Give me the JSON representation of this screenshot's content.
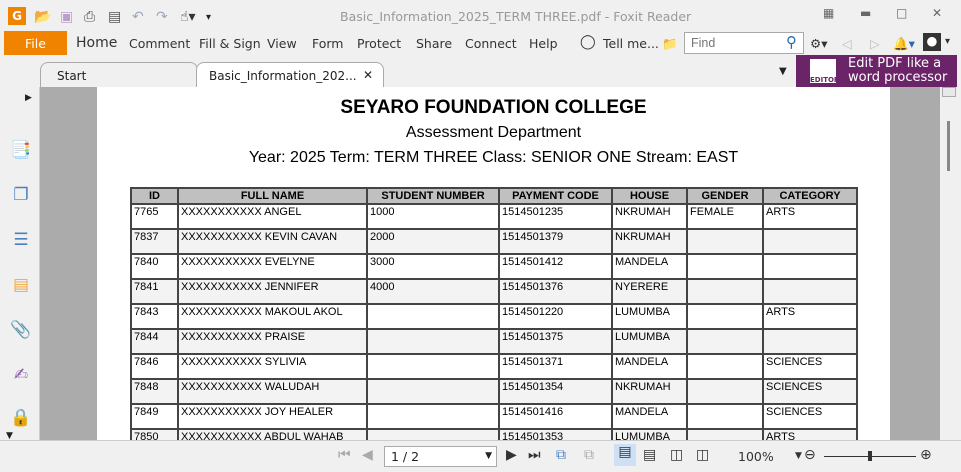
{
  "app": {
    "title": "Basic_Information_2025_TERM THREE.pdf - Foxit Reader",
    "accent": "#f08300"
  },
  "quick_access": [
    "foxit-logo-icon",
    "open-folder-icon",
    "save-icon",
    "print-icon",
    "scan-icon",
    "undo-icon",
    "redo-icon",
    "hand-tool-icon",
    "customize-icon"
  ],
  "ribbon": {
    "file": "File",
    "tabs": [
      "Home",
      "Comment",
      "Fill & Sign",
      "View",
      "Form",
      "Protect",
      "Share",
      "Connect",
      "Help"
    ],
    "tell_me": "Tell me...",
    "find_placeholder": "Find"
  },
  "doc_tabs": [
    {
      "label": "Start"
    },
    {
      "label": "Basic_Information_202...",
      "active": true
    }
  ],
  "promo": {
    "line1": "Edit PDF like a",
    "line2": "word processor",
    "badge": "EDITOR",
    "color": "#6b2468"
  },
  "sidebar": [
    "bookmark-icon",
    "pages-icon",
    "layers-icon",
    "comments-icon",
    "attachments-icon",
    "signature-icon",
    "security-icon"
  ],
  "document": {
    "school": "SEYARO FOUNDATION COLLEGE",
    "department": "Assessment Department",
    "info": "Year: 2025 Term: TERM THREE Class: SENIOR ONE Stream: EAST",
    "columns": [
      "ID",
      "FULL NAME",
      "STUDENT NUMBER",
      "PAYMENT CODE",
      "HOUSE",
      "GENDER",
      "CATEGORY"
    ],
    "rows": [
      [
        "7765",
        "XXXXXXXXXXX ANGEL",
        "1000",
        "1514501235",
        "NKRUMAH",
        "FEMALE",
        "ARTS"
      ],
      [
        "7837",
        "XXXXXXXXXXX KEVIN CAVAN",
        "2000",
        "1514501379",
        "NKRUMAH",
        "",
        ""
      ],
      [
        "7840",
        "XXXXXXXXXXX EVELYNE",
        "3000",
        "1514501412",
        "MANDELA",
        "",
        ""
      ],
      [
        "7841",
        "XXXXXXXXXXX JENNIFER",
        "4000",
        "1514501376",
        "NYERERE",
        "",
        ""
      ],
      [
        "7843",
        "XXXXXXXXXXX MAKOUL AKOL",
        "",
        "1514501220",
        "LUMUMBA",
        "",
        "ARTS"
      ],
      [
        "7844",
        "XXXXXXXXXXX PRAISE",
        "",
        "1514501375",
        "LUMUMBA",
        "",
        ""
      ],
      [
        "7846",
        "XXXXXXXXXXX SYLIVIA",
        "",
        "1514501371",
        "MANDELA",
        "",
        "SCIENCES"
      ],
      [
        "7848",
        "XXXXXXXXXXX WALUDAH",
        "",
        "1514501354",
        "NKRUMAH",
        "",
        "SCIENCES"
      ],
      [
        "7849",
        "XXXXXXXXXXX JOY HEALER",
        "",
        "1514501416",
        "MANDELA",
        "",
        "SCIENCES"
      ],
      [
        "7850",
        "XXXXXXXXXXX ABDUL WAHAB",
        "",
        "1514501353",
        "LUMUMBA",
        "",
        "ARTS"
      ]
    ]
  },
  "status": {
    "page": "1 / 2",
    "zoom": "100%",
    "zoom_slider_percent": 50
  }
}
